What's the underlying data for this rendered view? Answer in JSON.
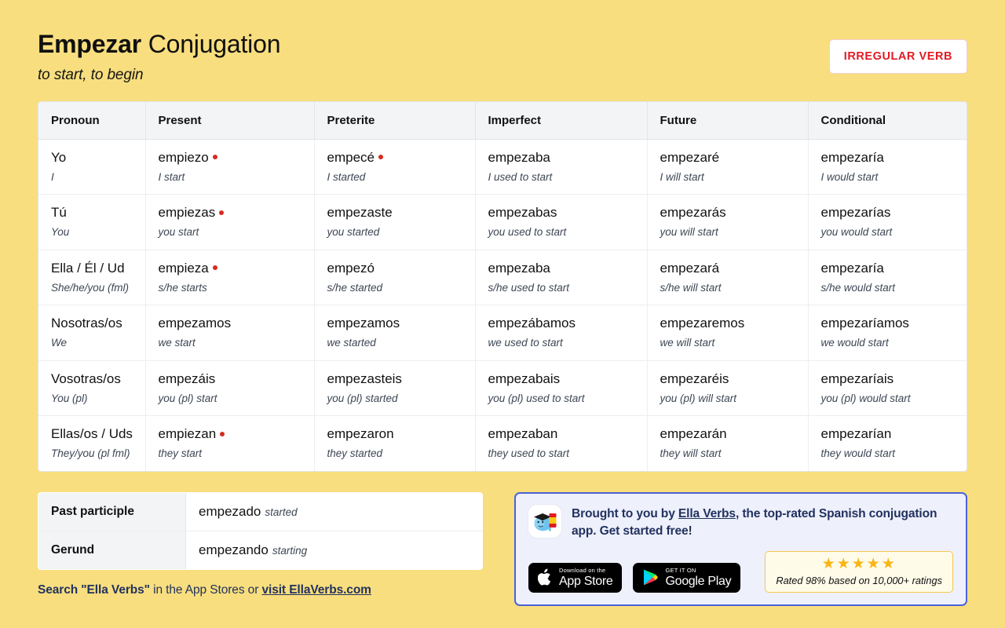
{
  "header": {
    "verb": "Empezar",
    "title_suffix": " Conjugation",
    "subtitle": "to start, to begin",
    "badge": "IRREGULAR VERB",
    "badge_color": "#e01b24"
  },
  "table": {
    "columns": [
      "Pronoun",
      "Present",
      "Preterite",
      "Imperfect",
      "Future",
      "Conditional"
    ],
    "irregular_dot_color": "#d62b1f",
    "rows": [
      {
        "pronoun": "Yo",
        "pronoun_gloss": "I",
        "present": "empiezo",
        "present_gloss": "I start",
        "present_irregular": true,
        "preterite": "empecé",
        "preterite_gloss": "I started",
        "preterite_irregular": true,
        "imperfect": "empezaba",
        "imperfect_gloss": "I used to start",
        "imperfect_irregular": false,
        "future": "empezaré",
        "future_gloss": "I will start",
        "future_irregular": false,
        "conditional": "empezaría",
        "conditional_gloss": "I would start",
        "conditional_irregular": false
      },
      {
        "pronoun": "Tú",
        "pronoun_gloss": "You",
        "present": "empiezas",
        "present_gloss": "you start",
        "present_irregular": true,
        "preterite": "empezaste",
        "preterite_gloss": "you started",
        "preterite_irregular": false,
        "imperfect": "empezabas",
        "imperfect_gloss": "you used to start",
        "imperfect_irregular": false,
        "future": "empezarás",
        "future_gloss": "you will start",
        "future_irregular": false,
        "conditional": "empezarías",
        "conditional_gloss": "you would start",
        "conditional_irregular": false
      },
      {
        "pronoun": "Ella / Él / Ud",
        "pronoun_gloss": "She/he/you (fml)",
        "present": "empieza",
        "present_gloss": "s/he starts",
        "present_irregular": true,
        "preterite": "empezó",
        "preterite_gloss": "s/he started",
        "preterite_irregular": false,
        "imperfect": "empezaba",
        "imperfect_gloss": "s/he used to start",
        "imperfect_irregular": false,
        "future": "empezará",
        "future_gloss": "s/he will start",
        "future_irregular": false,
        "conditional": "empezaría",
        "conditional_gloss": "s/he would start",
        "conditional_irregular": false
      },
      {
        "pronoun": "Nosotras/os",
        "pronoun_gloss": "We",
        "present": "empezamos",
        "present_gloss": "we start",
        "present_irregular": false,
        "preterite": "empezamos",
        "preterite_gloss": "we started",
        "preterite_irregular": false,
        "imperfect": "empezábamos",
        "imperfect_gloss": "we used to start",
        "imperfect_irregular": false,
        "future": "empezaremos",
        "future_gloss": "we will start",
        "future_irregular": false,
        "conditional": "empezaríamos",
        "conditional_gloss": "we would start",
        "conditional_irregular": false
      },
      {
        "pronoun": "Vosotras/os",
        "pronoun_gloss": "You (pl)",
        "present": "empezáis",
        "present_gloss": "you (pl) start",
        "present_irregular": false,
        "preterite": "empezasteis",
        "preterite_gloss": "you (pl) started",
        "preterite_irregular": false,
        "imperfect": "empezabais",
        "imperfect_gloss": "you (pl) used to start",
        "imperfect_irregular": false,
        "future": "empezaréis",
        "future_gloss": "you (pl) will start",
        "future_irregular": false,
        "conditional": "empezaríais",
        "conditional_gloss": "you (pl) would start",
        "conditional_irregular": false
      },
      {
        "pronoun": "Ellas/os / Uds",
        "pronoun_gloss": "They/you (pl fml)",
        "present": "empiezan",
        "present_gloss": "they start",
        "present_irregular": true,
        "preterite": "empezaron",
        "preterite_gloss": "they started",
        "preterite_irregular": false,
        "imperfect": "empezaban",
        "imperfect_gloss": "they used to start",
        "imperfect_irregular": false,
        "future": "empezarán",
        "future_gloss": "they will start",
        "future_irregular": false,
        "conditional": "empezarían",
        "conditional_gloss": "they would start",
        "conditional_irregular": false
      }
    ]
  },
  "nonfinite": {
    "participle_label": "Past participle",
    "participle_value": "empezado",
    "participle_gloss": "started",
    "gerund_label": "Gerund",
    "gerund_value": "empezando",
    "gerund_gloss": "starting"
  },
  "search_line": {
    "bold_prefix": "Search \"Ella Verbs\"",
    "middle": " in the App Stores or ",
    "link": "visit EllaVerbs.com"
  },
  "promo": {
    "text_before_link": "Brought to you by ",
    "link": "Ella Verbs",
    "text_after_link": ", the top-rated Spanish conjugation app. Get started free!",
    "border_color": "#4a63d8",
    "app_store": {
      "small": "Download on the",
      "big": "App Store"
    },
    "google_play": {
      "small": "GET IT ON",
      "big": "Google Play"
    },
    "rating": {
      "stars": "★★★★★",
      "text": "Rated 98% based on 10,000+ ratings",
      "star_color": "#f9b514"
    }
  }
}
